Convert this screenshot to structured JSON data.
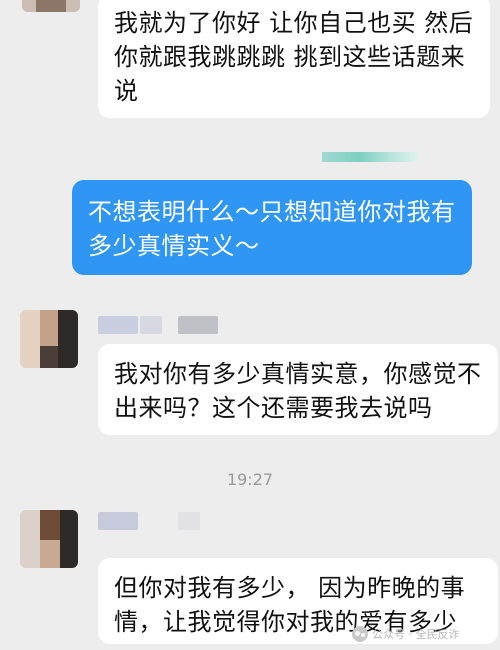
{
  "messages": [
    {
      "side": "left",
      "text": "我就为了你好 让你自己也买 然后你就跟我跳跳跳 挑到这些话题来说"
    },
    {
      "side": "right",
      "text": "不想表明什么～只想知道你对我有多少真情实义～"
    },
    {
      "side": "left",
      "text": "我对你有多少真情实意，你感觉不出来吗？这个还需要我去说吗"
    },
    {
      "side": "left",
      "text": "但你对我有多少， 因为昨晚的事情，让我觉得你对我的爱有多少"
    }
  ],
  "timestamp": "19:27",
  "watermark": "公众号 · 全民反诈",
  "colors": {
    "background": "#ededed",
    "bubble_left": "#ffffff",
    "bubble_right": "#2f96f4"
  }
}
